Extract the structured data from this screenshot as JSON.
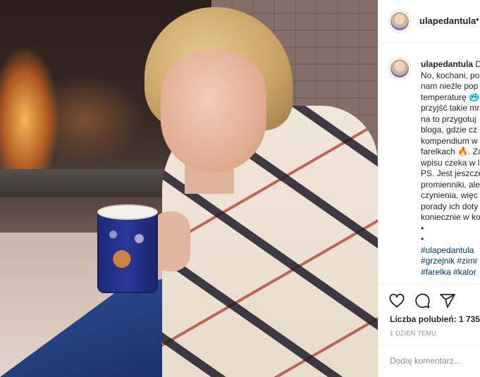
{
  "post": {
    "username": "ulapedantula",
    "more_dot": "•",
    "image_alt": "Woman in patterned cardigan holding a mug by a fireplace"
  },
  "caption": {
    "username": "ulapedantula",
    "lines": [
      "No, kochani, po",
      "nam nieźle pop",
      "temperaturę 🥶",
      "przyjść takie mr",
      "na to przygotuj",
      "bloga, gdzie cz",
      "kompendium w",
      "farelkach 🔥. Za",
      "wpisu czeka w l",
      "PS. Jest jeszcze",
      "promienniki, ale",
      "czynienia, więc",
      "porady ich doty",
      "koniecznie w ko",
      "•",
      "•"
    ],
    "tags_line1": "#ulapedantula",
    "tags_line2": "#grzejnik #zimr",
    "tags_line3": "#farelka #kalor",
    "header_suffix": "D"
  },
  "actions": {
    "like_icon": "heart-icon",
    "comment_icon": "comment-icon",
    "share_icon": "share-icon",
    "likes_text": "Liczba polubień: 1 735",
    "time_text": "1 DZIEŃ TEMU",
    "comment_placeholder": "Dodaj komentarz..."
  }
}
